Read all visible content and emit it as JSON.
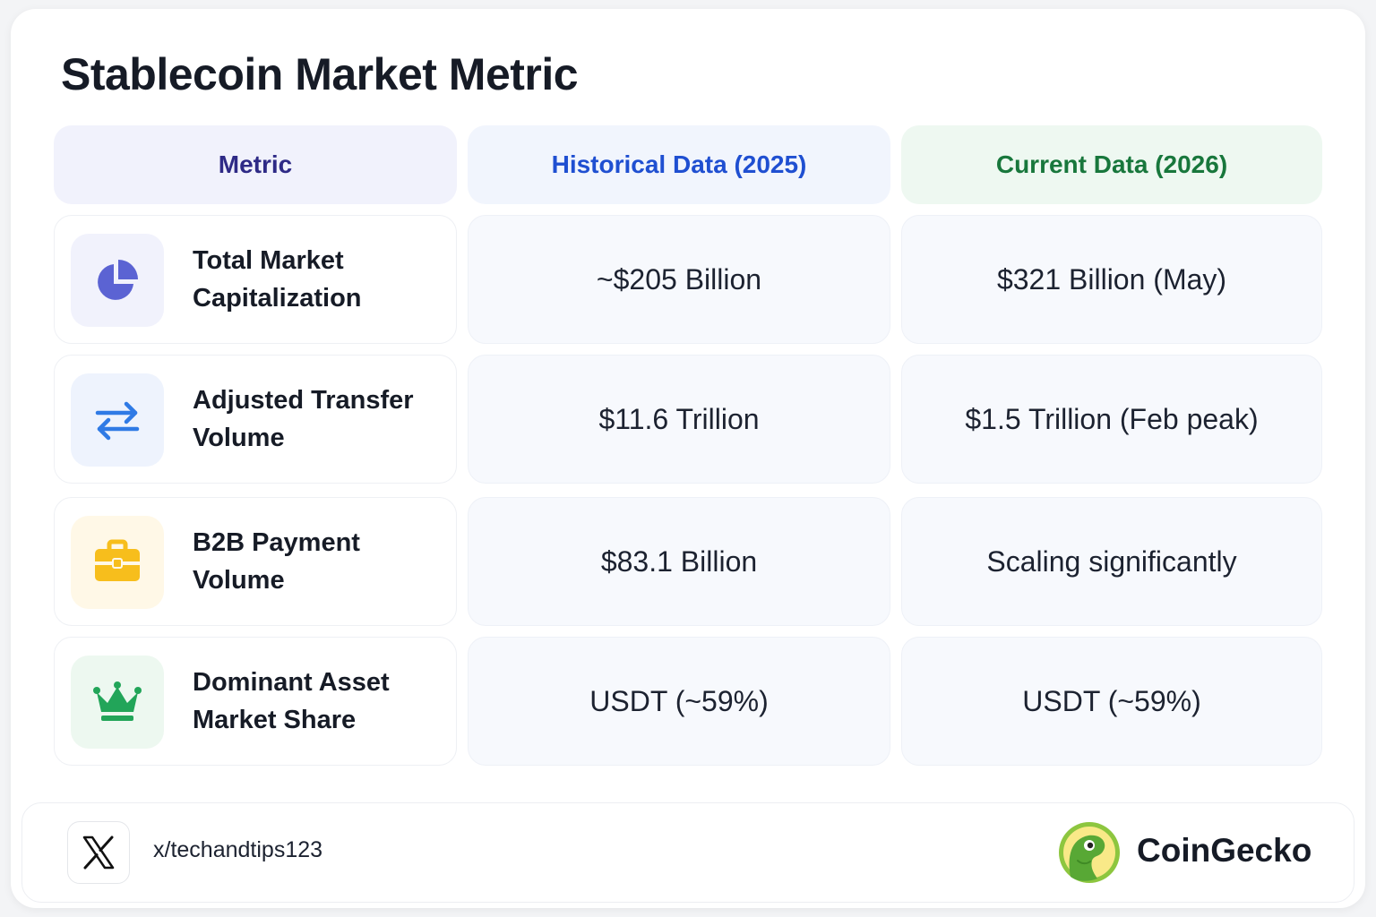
{
  "title": "Stablecoin Market Metric",
  "headers": {
    "metric": "Metric",
    "historical": "Historical Data (2025)",
    "current": "Current Data (2026)"
  },
  "rows": [
    {
      "label_line1": "Total Market",
      "label_line2": "Capitalization",
      "icon": "pie-chart-icon",
      "historical": "~$205 Billion",
      "current": "$321 Billion (May)"
    },
    {
      "label_line1": "Adjusted Transfer",
      "label_line2": "Volume",
      "icon": "transfer-arrows-icon",
      "historical": "$11.6 Trillion",
      "current": "$1.5 Trillion (Feb peak)"
    },
    {
      "label_line1": "B2B Payment",
      "label_line2": "Volume",
      "icon": "briefcase-icon",
      "historical": "$83.1 Billion",
      "current": "Scaling significantly"
    },
    {
      "label_line1": "Dominant Asset",
      "label_line2": "Market Share",
      "icon": "crown-icon",
      "historical": "USDT (~59%)",
      "current": "USDT (~59%)"
    }
  ],
  "footer": {
    "handle": "x/techandtips123",
    "brand": "CoinGecko",
    "social_icon": "x-logo-icon",
    "brand_icon": "coingecko-logo-icon"
  },
  "colors": {
    "metric_header": "#2e2a86",
    "historical_header": "#1f4fd1",
    "current_header": "#18773c",
    "pie_icon": "#5b63d3",
    "transfer_icon": "#2f7ae5",
    "briefcase_icon": "#f7be1c",
    "crown_icon": "#22a559"
  }
}
